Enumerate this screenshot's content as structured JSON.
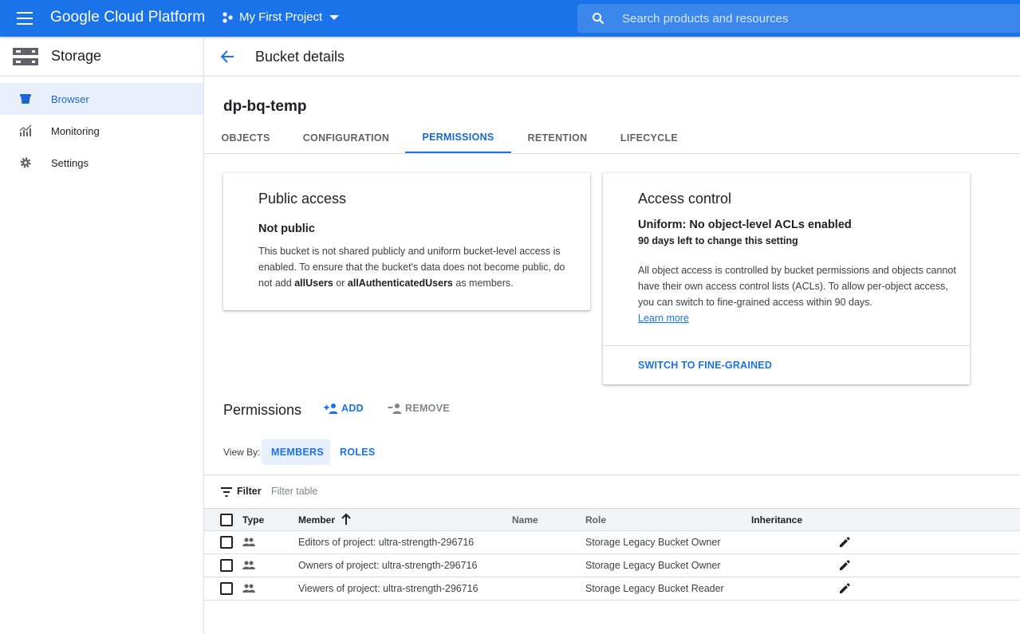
{
  "topbar": {
    "brand": "Google Cloud Platform",
    "project": "My First Project",
    "search_placeholder": "Search products and resources"
  },
  "sidebar": {
    "title": "Storage",
    "items": [
      {
        "label": "Browser",
        "icon": "bucket-icon",
        "active": true
      },
      {
        "label": "Monitoring",
        "icon": "chart-icon",
        "active": false
      },
      {
        "label": "Settings",
        "icon": "gear-icon",
        "active": false
      }
    ]
  },
  "header": {
    "title": "Bucket details"
  },
  "bucket_name": "dp-bq-temp",
  "tabs": [
    {
      "label": "OBJECTS"
    },
    {
      "label": "CONFIGURATION"
    },
    {
      "label": "PERMISSIONS",
      "active": true
    },
    {
      "label": "RETENTION"
    },
    {
      "label": "LIFECYCLE"
    }
  ],
  "public_access": {
    "title": "Public access",
    "status": "Not public",
    "body_1": "This bucket is not shared publicly and uniform bucket-level access is enabled. To ensure that the bucket's data does not become public, do not add ",
    "bold_1": "allUsers",
    "body_2": " or ",
    "bold_2": "allAuthenticatedUsers",
    "body_3": " as members."
  },
  "access_control": {
    "title": "Access control",
    "status": "Uniform: No object-level ACLs enabled",
    "days_left": "90 days left to change this setting",
    "body": "All object access is controlled by bucket permissions and objects cannot have their own access control lists (ACLs). To allow per-object access, you can switch to fine-grained access within 90 days.",
    "learn_more": "Learn more",
    "switch_label": "SWITCH TO FINE-GRAINED"
  },
  "permissions": {
    "title": "Permissions",
    "add_label": "ADD",
    "remove_label": "REMOVE",
    "view_by_label": "View By:",
    "members_label": "MEMBERS",
    "roles_label": "ROLES",
    "filter_label": "Filter",
    "filter_placeholder": "Filter table",
    "columns": {
      "type": "Type",
      "member": "Member",
      "name": "Name",
      "role": "Role",
      "inheritance": "Inheritance"
    },
    "rows": [
      {
        "member": "Editors of project: ultra-strength-296716",
        "name": "",
        "role": "Storage Legacy Bucket Owner",
        "inheritance": ""
      },
      {
        "member": "Owners of project: ultra-strength-296716",
        "name": "",
        "role": "Storage Legacy Bucket Owner",
        "inheritance": ""
      },
      {
        "member": "Viewers of project: ultra-strength-296716",
        "name": "",
        "role": "Storage Legacy Bucket Reader",
        "inheritance": ""
      }
    ]
  },
  "colors": {
    "brand_blue": "#1a73e8",
    "active_nav_bg": "#e8f0fe",
    "text_primary": "#202124",
    "text_secondary": "#5f6368"
  }
}
